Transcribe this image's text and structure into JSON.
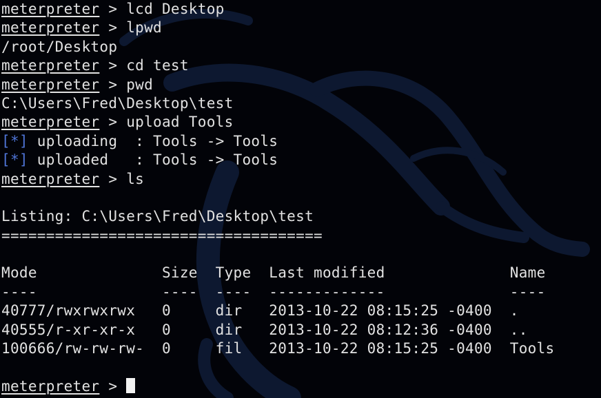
{
  "prompt": "meterpreter",
  "lines": [
    {
      "type": "cmd",
      "text": " > lcd Desktop"
    },
    {
      "type": "cmd",
      "text": " > lpwd"
    },
    {
      "type": "out",
      "text": "/root/Desktop"
    },
    {
      "type": "cmd",
      "text": " > cd test"
    },
    {
      "type": "cmd",
      "text": " > pwd"
    },
    {
      "type": "out",
      "text": "C:\\Users\\Fred\\Desktop\\test"
    },
    {
      "type": "cmd",
      "text": " > upload Tools"
    },
    {
      "type": "status",
      "marker": "[*]",
      "text": " uploading  : Tools -> Tools"
    },
    {
      "type": "status",
      "marker": "[*]",
      "text": " uploaded   : Tools -> Tools"
    },
    {
      "type": "cmd",
      "text": " > ls"
    },
    {
      "type": "blank",
      "text": ""
    },
    {
      "type": "out",
      "text": "Listing: C:\\Users\\Fred\\Desktop\\test"
    },
    {
      "type": "out",
      "text": "===================================="
    },
    {
      "type": "blank",
      "text": ""
    },
    {
      "type": "out",
      "text": "Mode              Size  Type  Last modified              Name"
    },
    {
      "type": "out",
      "text": "----              ----  ----  -------------              ----"
    },
    {
      "type": "out",
      "text": "40777/rwxrwxrwx   0     dir   2013-10-22 08:15:25 -0400  ."
    },
    {
      "type": "out",
      "text": "40555/r-xr-xr-x   0     dir   2013-10-22 08:12:36 -0400  .."
    },
    {
      "type": "out",
      "text": "100666/rw-rw-rw-  0     fil   2013-10-22 08:15:25 -0400  Tools"
    },
    {
      "type": "blank",
      "text": ""
    },
    {
      "type": "input",
      "text": " > "
    }
  ],
  "colors": {
    "background": "#020308",
    "text": "#e2e2e2",
    "status": "#4f74d6",
    "watermark": "#0b1424"
  },
  "watermark_icon": "kali-dragon-icon"
}
